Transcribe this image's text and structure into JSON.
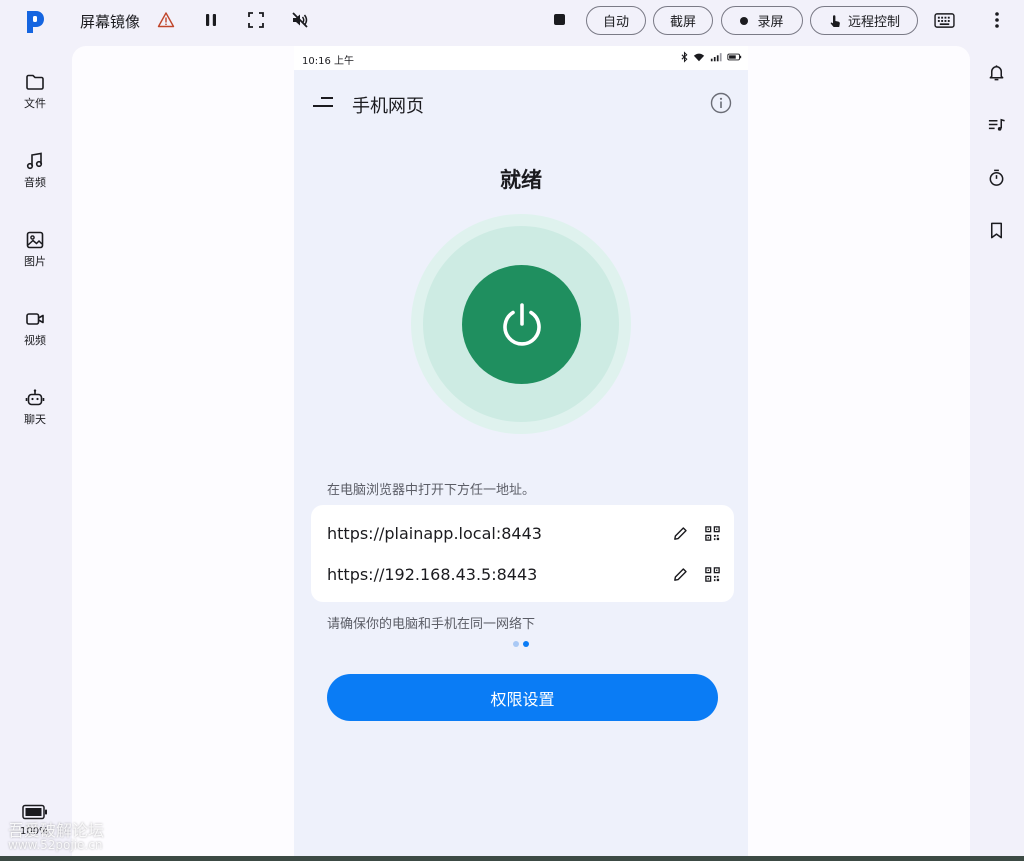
{
  "app": {
    "title": "屏幕镜像"
  },
  "toolbar": {
    "auto_label": "自动",
    "screenshot_label": "截屏",
    "record_label": "录屏",
    "remote_label": "远程控制"
  },
  "sidebar": {
    "items": [
      {
        "label": "文件",
        "icon": "folder-icon"
      },
      {
        "label": "音频",
        "icon": "music-note-icon"
      },
      {
        "label": "图片",
        "icon": "image-icon"
      },
      {
        "label": "视频",
        "icon": "video-camera-icon"
      },
      {
        "label": "聊天",
        "icon": "robot-icon"
      }
    ],
    "battery": "100%"
  },
  "right_rail": {
    "icons": [
      "bell-icon",
      "playlist-icon",
      "timer-icon",
      "bookmark-icon"
    ]
  },
  "phone": {
    "status_time": "10:16 上午",
    "app_title": "手机网页",
    "state": "就绪",
    "hint": "在电脑浏览器中打开下方任一地址。",
    "urls": [
      "https://plainapp.local:8443",
      "https://192.168.43.5:8443"
    ],
    "note": "请确保你的电脑和手机在同一网络下",
    "permission_button": "权限设置",
    "pager": {
      "count": 2,
      "active": 2
    }
  },
  "watermark": {
    "line1": "吾爱破解论坛",
    "line2": "www.52pojie.cn"
  },
  "colors": {
    "accent": "#0a7cf5",
    "power": "#1f8f5f",
    "halo": "#cdebe3",
    "logo": "#1565e0"
  }
}
